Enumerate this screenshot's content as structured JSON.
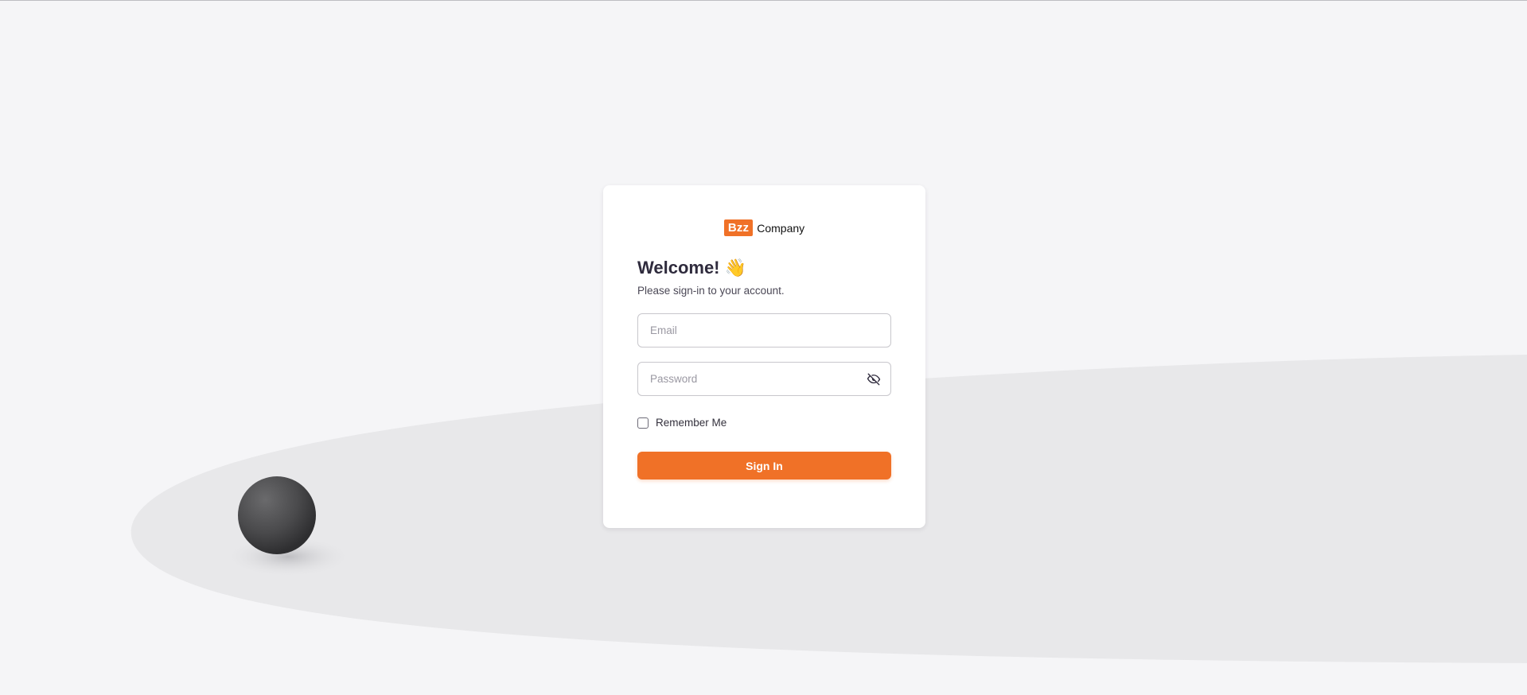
{
  "colors": {
    "accent": "#f07127",
    "page_background": "#f5f5f7",
    "card_background": "#ffffff"
  },
  "brand": {
    "badge_text": "Bzz",
    "name": "Company"
  },
  "login": {
    "welcome_title": "Welcome! 👋",
    "subtitle": "Please sign-in to your account.",
    "email_placeholder": "Email",
    "email_value": "",
    "password_placeholder": "Password",
    "password_value": "",
    "password_toggle_icon": "eye-off-icon",
    "remember_label": "Remember Me",
    "remember_checked": false,
    "submit_label": "Sign In"
  }
}
